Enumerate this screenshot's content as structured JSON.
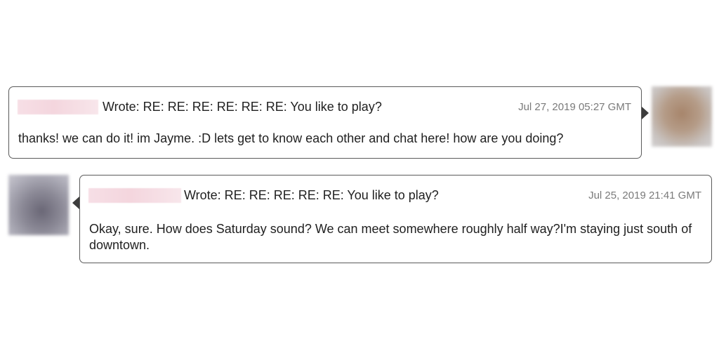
{
  "messages": [
    {
      "subject": "Wrote: RE: RE: RE: RE: RE: RE: You like to play?",
      "timestamp": "Jul 27, 2019 05:27 GMT",
      "body": "thanks! we can do it! im Jayme. :D lets get to know each other and chat here! how are you doing?"
    },
    {
      "subject": "Wrote: RE: RE: RE: RE: RE: You like to play?",
      "timestamp": "Jul 25, 2019 21:41 GMT",
      "body": "Okay, sure. How does Saturday sound? We can meet somewhere roughly half way?I'm staying just south of downtown."
    }
  ]
}
